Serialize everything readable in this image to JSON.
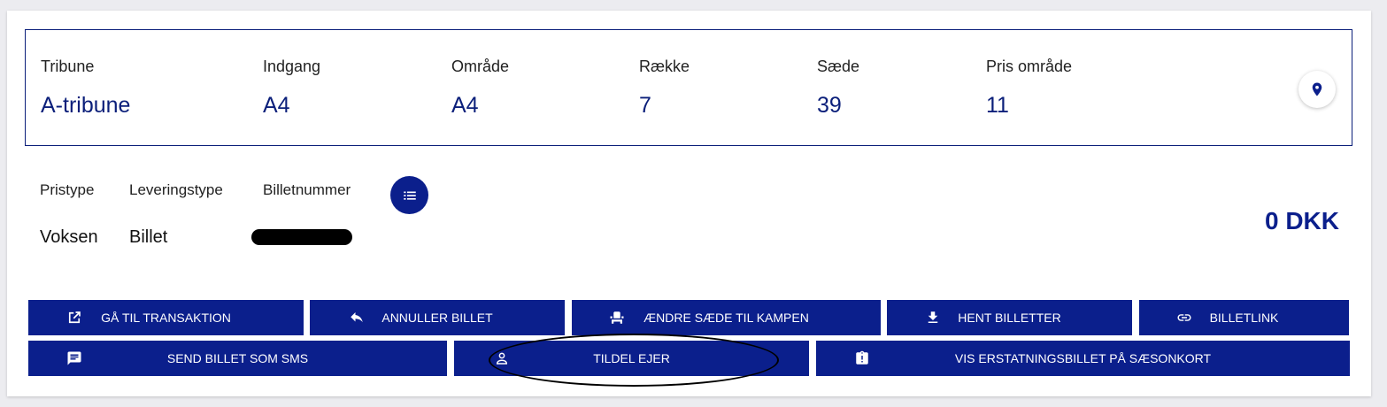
{
  "seat": {
    "tribune_label": "Tribune",
    "tribune_value": "A-tribune",
    "entrance_label": "Indgang",
    "entrance_value": "A4",
    "area_label": "Område",
    "area_value": "A4",
    "row_label": "Række",
    "row_value": "7",
    "seat_label": "Sæde",
    "seat_value": "39",
    "price_area_label": "Pris område",
    "price_area_value": "11"
  },
  "ticket": {
    "price_type_label": "Pristype",
    "price_type_value": "Voksen",
    "delivery_label": "Leveringstype",
    "delivery_value": "Billet",
    "ticket_number_label": "Billetnummer",
    "price": "0 DKK"
  },
  "actions": {
    "goto_transaction": "GÅ TIL TRANSAKTION",
    "cancel_ticket": "ANNULLER BILLET",
    "change_seat": "ÆNDRE SÆDE TIL KAMPEN",
    "get_tickets": "HENT BILLETTER",
    "ticket_link": "BILLETLINK",
    "send_sms": "SEND BILLET SOM SMS",
    "assign_owner": "TILDEL EJER",
    "show_replacement": "VIS ERSTATNINGSBILLET PÅ SÆSONKORT"
  },
  "icons": {
    "location": "location-pin-icon",
    "list": "list-icon",
    "open_external": "open-external-icon",
    "reply": "reply-icon",
    "seat": "seat-icon",
    "download": "download-icon",
    "link": "link-icon",
    "message": "message-icon",
    "person": "person-icon",
    "badge": "badge-icon"
  },
  "colors": {
    "primary": "#0b1f8c",
    "text_dark": "#222222",
    "background": "#ececf0"
  }
}
